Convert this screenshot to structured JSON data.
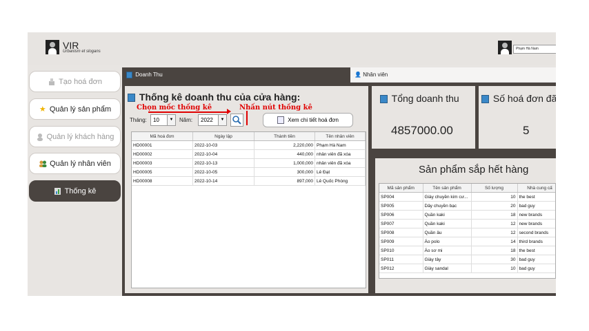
{
  "app": {
    "brand": "VIR",
    "slogan": "Urbanism et slogans",
    "current_user": "Phạm Hà Nam"
  },
  "sidebar": {
    "items": [
      {
        "label": "Tạo hoá đơn",
        "icon": "invoice-icon",
        "state": "disabled"
      },
      {
        "label": "Quản lý sản phẩm",
        "icon": "star-icon",
        "state": "normal"
      },
      {
        "label": "Quản lý khách hàng",
        "icon": "user-icon",
        "state": "disabled"
      },
      {
        "label": "Quản lý nhân viên",
        "icon": "users-icon",
        "state": "normal"
      },
      {
        "label": "Thống kê",
        "icon": "stats-icon",
        "state": "active"
      }
    ]
  },
  "tabs": [
    {
      "label": "Doanh Thu",
      "active": true
    },
    {
      "label": "Nhân viên",
      "active": false
    }
  ],
  "revenue": {
    "title": "Thống kê doanh thu của cửa hàng:",
    "annotation_select": "Chọn mốc thống kê",
    "annotation_button": "Nhấn nút thống kê",
    "month_label": "Tháng:",
    "month_value": "10",
    "year_label": "Năm:",
    "year_value": "2022",
    "detail_button": "Xem chi tiết hoá đơn",
    "table_headers": [
      "Mã hoá đơn",
      "Ngày lập",
      "Thành tiền",
      "Tên nhân viên"
    ],
    "table_rows": [
      [
        "HD00001",
        "2022-10-03",
        "2,220,000",
        "Phạm Hà Nam"
      ],
      [
        "HD00002",
        "2022-10-04",
        "440,000",
        "nhân viên đã xóa"
      ],
      [
        "HD00003",
        "2022-10-13",
        "1,000,000",
        "nhân viên đã xóa"
      ],
      [
        "HD00005",
        "2022-10-05",
        "300,000",
        "Lê Đạt"
      ],
      [
        "HD00008",
        "2022-10-14",
        "897,000",
        "Lê Quốc Phòng"
      ]
    ]
  },
  "summary": {
    "total_revenue_label": "Tổng doanh thu",
    "total_revenue_value": "4857000.00",
    "invoice_count_label": "Số hoá đơn đã",
    "invoice_count_value": "5"
  },
  "low_stock": {
    "title": "Sản phẩm sắp hết hàng",
    "table_headers": [
      "Mã sản phẩm",
      "Tên sản phẩm",
      "Số lượng",
      "Nhà cung cấ"
    ],
    "table_rows": [
      [
        "SP004",
        "Giày chuyền kim cư...",
        "10",
        "the best"
      ],
      [
        "SP005",
        "Dây chuyền bạc",
        "20",
        "bad guy"
      ],
      [
        "SP006",
        "Quần kaki",
        "18",
        "new brands"
      ],
      [
        "SP007",
        "Quần kaki",
        "12",
        "new brands"
      ],
      [
        "SP008",
        "Quần âu",
        "12",
        "second brands"
      ],
      [
        "SP009",
        "Áo polo",
        "14",
        "third brands"
      ],
      [
        "SP010",
        "Áo sơ mi",
        "18",
        "the best"
      ],
      [
        "SP011",
        "Giày tây",
        "30",
        "bad guy"
      ],
      [
        "SP012",
        "Giày sandal",
        "10",
        "bad guy"
      ]
    ]
  }
}
